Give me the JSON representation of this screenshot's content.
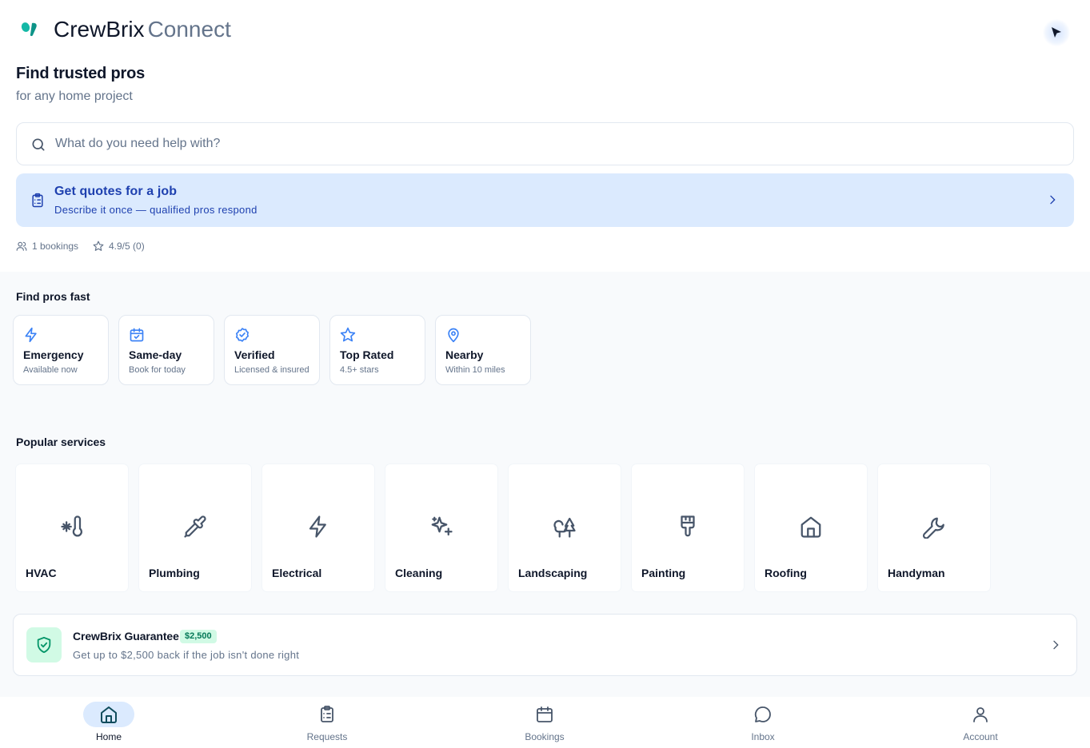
{
  "header": {
    "brand_name": "CrewBrix",
    "brand_sub": "Connect",
    "logo_color": "#14b8a6",
    "logo_color_2": "#0d9488"
  },
  "hero": {
    "title": "Find trusted pros",
    "subtitle": "for any home project"
  },
  "search": {
    "placeholder": "What do you need help with?",
    "value": ""
  },
  "quote_banner": {
    "title": "Get quotes for a job",
    "description": "Describe it once — qualified pros respond"
  },
  "stats": {
    "bookings": "1 bookings",
    "rating": "4.9/5 (0)"
  },
  "find_fast": {
    "title": "Find pros fast",
    "items": [
      {
        "title": "Emergency",
        "subtitle": "Available now",
        "icon": "lightning-icon"
      },
      {
        "title": "Same-day",
        "subtitle": "Book for today",
        "icon": "calendar-check-icon"
      },
      {
        "title": "Verified",
        "subtitle": "Licensed & insured",
        "icon": "badge-check-icon"
      },
      {
        "title": "Top Rated",
        "subtitle": "4.5+ stars",
        "icon": "star-icon"
      },
      {
        "title": "Nearby",
        "subtitle": "Within 10 miles",
        "icon": "map-pin-icon"
      }
    ]
  },
  "popular": {
    "title": "Popular services",
    "items": [
      {
        "label": "HVAC",
        "icon": "thermometer-snowflake-icon"
      },
      {
        "label": "Plumbing",
        "icon": "pipette-icon"
      },
      {
        "label": "Electrical",
        "icon": "lightning-icon"
      },
      {
        "label": "Cleaning",
        "icon": "sparkles-icon"
      },
      {
        "label": "Landscaping",
        "icon": "trees-icon"
      },
      {
        "label": "Painting",
        "icon": "paintbrush-icon"
      },
      {
        "label": "Roofing",
        "icon": "house-icon"
      },
      {
        "label": "Handyman",
        "icon": "wrench-icon"
      }
    ]
  },
  "guarantee": {
    "title": "CrewBrix Guarantee",
    "badge": "$2,500",
    "description": "Get up to $2,500 back if the job isn't done right"
  },
  "nav": {
    "items": [
      {
        "label": "Home",
        "icon": "home-icon",
        "active": true
      },
      {
        "label": "Requests",
        "icon": "clipboard-icon",
        "active": false
      },
      {
        "label": "Bookings",
        "icon": "calendar-icon",
        "active": false
      },
      {
        "label": "Inbox",
        "icon": "chat-bubble-icon",
        "active": false
      },
      {
        "label": "Account",
        "icon": "user-icon",
        "active": false
      }
    ]
  },
  "colors": {
    "accent_blue": "#3b82f6",
    "banner_bg": "#dbeafe",
    "banner_text": "#1e40af",
    "guarantee_green": "#059669",
    "muted_text": "#64748b"
  }
}
